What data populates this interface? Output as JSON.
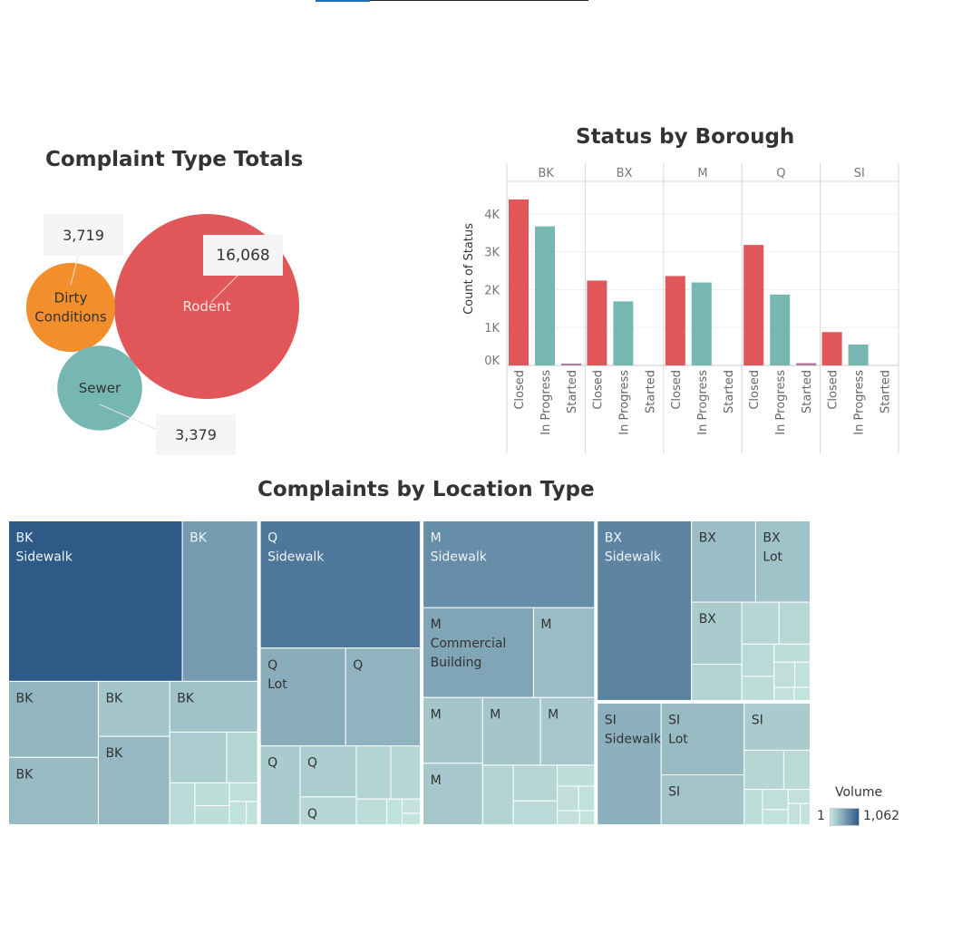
{
  "colors": {
    "rodent": "#e15759",
    "dirty": "#f28e2b",
    "sewer": "#76b7b2",
    "closed": "#e15759",
    "in_progress": "#76b7b2",
    "started": "#b07aa1",
    "tm_min": "#c7e6df",
    "tm_max": "#2e5a87"
  },
  "chart_data": [
    {
      "type": "bubble",
      "title": "Complaint Type Totals",
      "items": [
        {
          "label": "Rodent",
          "value": 16068,
          "value_label": "16,068",
          "color": "#e15759"
        },
        {
          "label": "Dirty Conditions",
          "label_lines": [
            "Dirty",
            "Conditions"
          ],
          "value": 3719,
          "value_label": "3,719",
          "color": "#f28e2b"
        },
        {
          "label": "Sewer",
          "value": 3379,
          "value_label": "3,379",
          "color": "#76b7b2"
        }
      ]
    },
    {
      "type": "bar",
      "title": "Status by Borough",
      "ylabel": "Count of Status",
      "ylim": [
        0,
        4500
      ],
      "yticks": [
        {
          "value": 0,
          "label": "0K"
        },
        {
          "value": 1000,
          "label": "1K"
        },
        {
          "value": 2000,
          "label": "2K"
        },
        {
          "value": 3000,
          "label": "3K"
        },
        {
          "value": 4000,
          "label": "4K"
        }
      ],
      "panels": [
        "BK",
        "BX",
        "M",
        "Q",
        "SI"
      ],
      "categories": [
        "Closed",
        "In Progress",
        "Started"
      ],
      "series": [
        {
          "name": "Closed",
          "values": [
            4380,
            2240,
            2360,
            3180,
            880
          ]
        },
        {
          "name": "In Progress",
          "values": [
            3670,
            1690,
            2190,
            1870,
            550
          ]
        },
        {
          "name": "Started",
          "values": [
            30,
            0,
            0,
            60,
            0
          ]
        }
      ],
      "grid": true
    },
    {
      "type": "treemap",
      "title": "Complaints by Location Type",
      "legend": {
        "title": "Volume",
        "min": "1",
        "max": "1,062",
        "min_value": 1,
        "max_value": 1062
      },
      "groups": [
        {
          "name": "BK",
          "cells": [
            {
              "lines": [
                "BK",
                "Sidewalk"
              ],
              "value": 1062
            },
            {
              "lines": [
                "BK"
              ],
              "value": 460
            },
            {
              "lines": [
                "BK"
              ],
              "value": 260
            },
            {
              "lines": [
                "BK"
              ],
              "value": 230
            },
            {
              "lines": [
                "BK"
              ],
              "value": 150
            },
            {
              "lines": [
                "BK"
              ],
              "value": 240
            },
            {
              "lines": [
                "BK"
              ],
              "value": 170
            },
            {
              "lines": [],
              "value": 110
            },
            {
              "lines": [],
              "value": 60
            },
            {
              "lines": [],
              "value": 40
            },
            {
              "lines": [],
              "value": 30
            },
            {
              "lines": [],
              "value": 25
            },
            {
              "lines": [],
              "value": 20
            },
            {
              "lines": [],
              "value": 15
            },
            {
              "lines": [],
              "value": 10
            }
          ]
        },
        {
          "name": "Q",
          "cells": [
            {
              "lines": [
                "Q",
                "Sidewalk"
              ],
              "value": 780
            },
            {
              "lines": [
                "Q",
                "Lot"
              ],
              "value": 320
            },
            {
              "lines": [
                "Q"
              ],
              "value": 280
            },
            {
              "lines": [
                "Q"
              ],
              "value": 120
            },
            {
              "lines": [
                "Q"
              ],
              "value": 110
            },
            {
              "lines": [
                "Q"
              ],
              "value": 60
            },
            {
              "lines": [],
              "value": 70
            },
            {
              "lines": [],
              "value": 60
            },
            {
              "lines": [],
              "value": 30
            },
            {
              "lines": [],
              "value": 15
            },
            {
              "lines": [],
              "value": 10
            },
            {
              "lines": [],
              "value": 8
            }
          ]
        },
        {
          "name": "M",
          "cells": [
            {
              "lines": [
                "M",
                "Sidewalk"
              ],
              "value": 570
            },
            {
              "lines": [
                "M",
                "Commercial",
                "Building"
              ],
              "value": 380
            },
            {
              "lines": [
                "M"
              ],
              "value": 210
            },
            {
              "lines": [
                "M"
              ],
              "value": 150
            },
            {
              "lines": [
                "M"
              ],
              "value": 140
            },
            {
              "lines": [
                "M"
              ],
              "value": 150
            },
            {
              "lines": [
                "M"
              ],
              "value": 140
            },
            {
              "lines": [],
              "value": 70
            },
            {
              "lines": [],
              "value": 60
            },
            {
              "lines": [],
              "value": 40
            },
            {
              "lines": [],
              "value": 30
            },
            {
              "lines": [],
              "value": 20
            },
            {
              "lines": [],
              "value": 15
            },
            {
              "lines": [],
              "value": 12
            },
            {
              "lines": [],
              "value": 8
            }
          ]
        },
        {
          "name": "BX",
          "cells": [
            {
              "lines": [
                "BX",
                "Sidewalk"
              ],
              "value": 650
            },
            {
              "lines": [
                "BX"
              ],
              "value": 200
            },
            {
              "lines": [
                "BX",
                "Lot"
              ],
              "value": 170
            },
            {
              "lines": [
                "BX"
              ],
              "value": 120
            },
            {
              "lines": [],
              "value": 70
            },
            {
              "lines": [],
              "value": 60
            },
            {
              "lines": [],
              "value": 50
            },
            {
              "lines": [],
              "value": 40
            },
            {
              "lines": [],
              "value": 30
            },
            {
              "lines": [],
              "value": 25
            },
            {
              "lines": [],
              "value": 20
            },
            {
              "lines": [],
              "value": 15
            },
            {
              "lines": [],
              "value": 10
            },
            {
              "lines": [],
              "value": 8
            }
          ]
        },
        {
          "name": "SI",
          "cells": [
            {
              "lines": [
                "SI",
                "Sidewalk"
              ],
              "value": 300
            },
            {
              "lines": [
                "SI",
                "Lot"
              ],
              "value": 230
            },
            {
              "lines": [
                "SI"
              ],
              "value": 160
            },
            {
              "lines": [
                "SI"
              ],
              "value": 120
            },
            {
              "lines": [],
              "value": 60
            },
            {
              "lines": [],
              "value": 40
            },
            {
              "lines": [],
              "value": 25
            },
            {
              "lines": [],
              "value": 20
            },
            {
              "lines": [],
              "value": 15
            },
            {
              "lines": [],
              "value": 12
            },
            {
              "lines": [],
              "value": 10
            },
            {
              "lines": [],
              "value": 8
            }
          ]
        }
      ]
    }
  ]
}
